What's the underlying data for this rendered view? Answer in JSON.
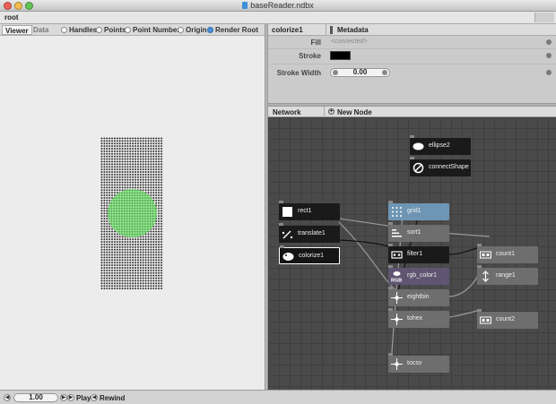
{
  "window": {
    "title": "baseReader.ndbx"
  },
  "address": {
    "root": "root"
  },
  "viewer": {
    "tabs": [
      {
        "label": "Viewer"
      },
      {
        "label": "Data"
      }
    ],
    "options": [
      {
        "label": "Handles",
        "checked": false
      },
      {
        "label": "Points",
        "checked": false
      },
      {
        "label": "Point Numbers",
        "checked": false
      },
      {
        "label": "Origin",
        "checked": false
      },
      {
        "label": "Render Root",
        "checked": true
      }
    ],
    "colors": {
      "ellipse_fill": "#8ee98a",
      "points": "#2a2a2a"
    }
  },
  "metadata": {
    "node": "colorize1",
    "label": "Metadata",
    "params": {
      "fill": {
        "label": "Fill",
        "value": "<connected>"
      },
      "stroke": {
        "label": "Stroke",
        "value": "#000000"
      },
      "stroke_width": {
        "label": "Stroke Width",
        "value": "0.00"
      }
    }
  },
  "network": {
    "label": "Network",
    "new_node": "New Node",
    "nodes": [
      {
        "name": "ellipse2",
        "icon": "ellipse-icon",
        "style": "dark"
      },
      {
        "name": "connectShape",
        "icon": "no-connect-icon",
        "style": "dark"
      },
      {
        "name": "rect1",
        "icon": "rect-icon",
        "style": "dark"
      },
      {
        "name": "translate1",
        "icon": "translate-icon",
        "style": "dark"
      },
      {
        "name": "colorize1",
        "icon": "colorize-icon",
        "style": "selected"
      },
      {
        "name": "grid1",
        "icon": "grid-icon",
        "style": "blue"
      },
      {
        "name": "sort1",
        "icon": "sort-icon",
        "style": "gray"
      },
      {
        "name": "filter1",
        "icon": "filter-icon",
        "style": "dark"
      },
      {
        "name": "rgb_color1",
        "icon": "rgb-icon",
        "style": "purple"
      },
      {
        "name": "eightbin",
        "icon": "point-icon",
        "style": "gray"
      },
      {
        "name": "tohex",
        "icon": "point-icon",
        "style": "gray"
      },
      {
        "name": "tocsv",
        "icon": "point-icon",
        "style": "gray"
      },
      {
        "name": "count1",
        "icon": "count-icon",
        "style": "gray"
      },
      {
        "name": "range1",
        "icon": "range-icon",
        "style": "gray"
      },
      {
        "name": "count2",
        "icon": "count-icon",
        "style": "gray"
      }
    ]
  },
  "playback": {
    "frame": "1.00",
    "play": "Play",
    "rewind": "Rewind"
  }
}
